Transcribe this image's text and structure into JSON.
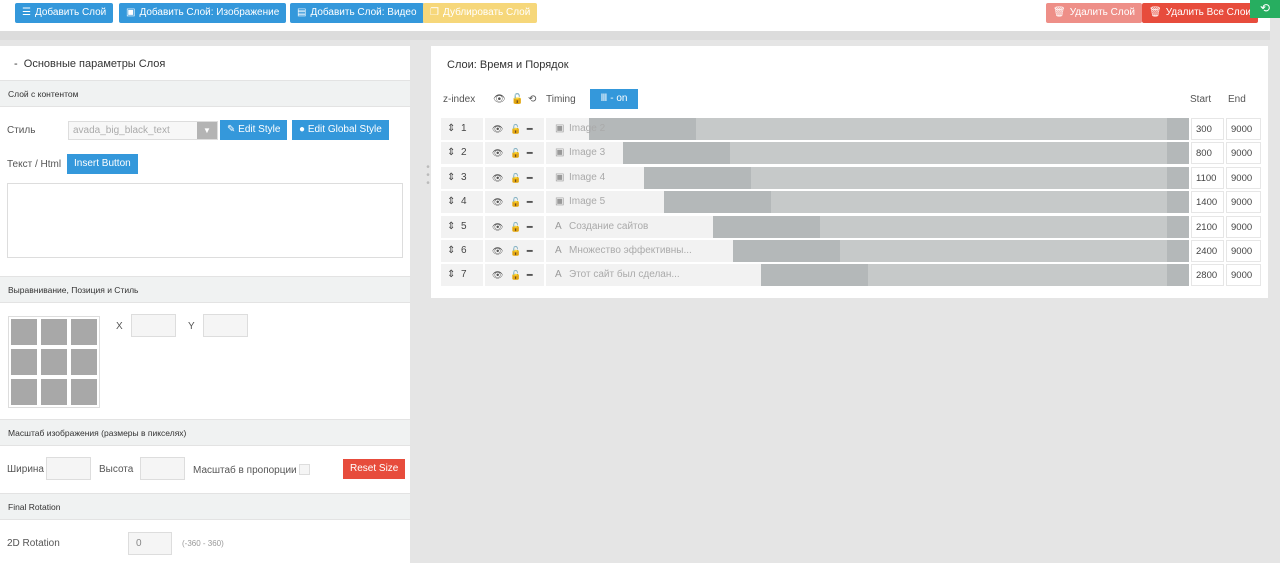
{
  "toolbar": {
    "add_layer": "Добавить Слой",
    "add_image_layer": "Добавить Слой: Изображение",
    "add_video_layer": "Добавить Слой: Видео",
    "duplicate_layer": "Дублировать Слой",
    "delete_layer": "Удалить Слой",
    "delete_all_layers": "Удалить Все Слои"
  },
  "left_panel": {
    "title": "Основные параметры Слоя",
    "content_section": "Слой с контентом",
    "style_label": "Стиль",
    "style_value": "avada_big_black_text",
    "edit_style": "Edit Style",
    "edit_global_style": "Edit Global Style",
    "text_html_label": "Текст / Html",
    "insert_button": "Insert Button",
    "align_section": "Выравнивание, Позиция и Стиль",
    "x_label": "X",
    "y_label": "Y",
    "scale_section": "Масштаб изображения (размеры в пикселях)",
    "width_label": "Ширина",
    "height_label": "Высота",
    "proportional_label": "Масштаб в пропорции",
    "reset_size": "Reset Size",
    "rotation_section": "Final Rotation",
    "rotation_label": "2D Rotation",
    "rotation_value": "0",
    "rotation_range": "(-360 - 360)"
  },
  "right_panel": {
    "title": "Слои: Время и Порядок",
    "zindex_header": "z-index",
    "timing_header": "Timing",
    "timing_toggle": "- on",
    "start_header": "Start",
    "end_header": "End",
    "layers": [
      {
        "z": "1",
        "type": "image",
        "name": "Image 2",
        "start": "300",
        "end": "9000"
      },
      {
        "z": "2",
        "type": "image",
        "name": "Image 3",
        "start": "800",
        "end": "9000"
      },
      {
        "z": "3",
        "type": "image",
        "name": "Image 4",
        "start": "1100",
        "end": "9000"
      },
      {
        "z": "4",
        "type": "image",
        "name": "Image 5",
        "start": "1400",
        "end": "9000"
      },
      {
        "z": "5",
        "type": "text",
        "name": "Создание сайтов",
        "start": "2100",
        "end": "9000"
      },
      {
        "z": "6",
        "type": "text",
        "name": "Множество эффективны...",
        "start": "2400",
        "end": "9000"
      },
      {
        "z": "7",
        "type": "text",
        "name": "Этот сайт был сделан...",
        "start": "2800",
        "end": "9000"
      }
    ]
  }
}
